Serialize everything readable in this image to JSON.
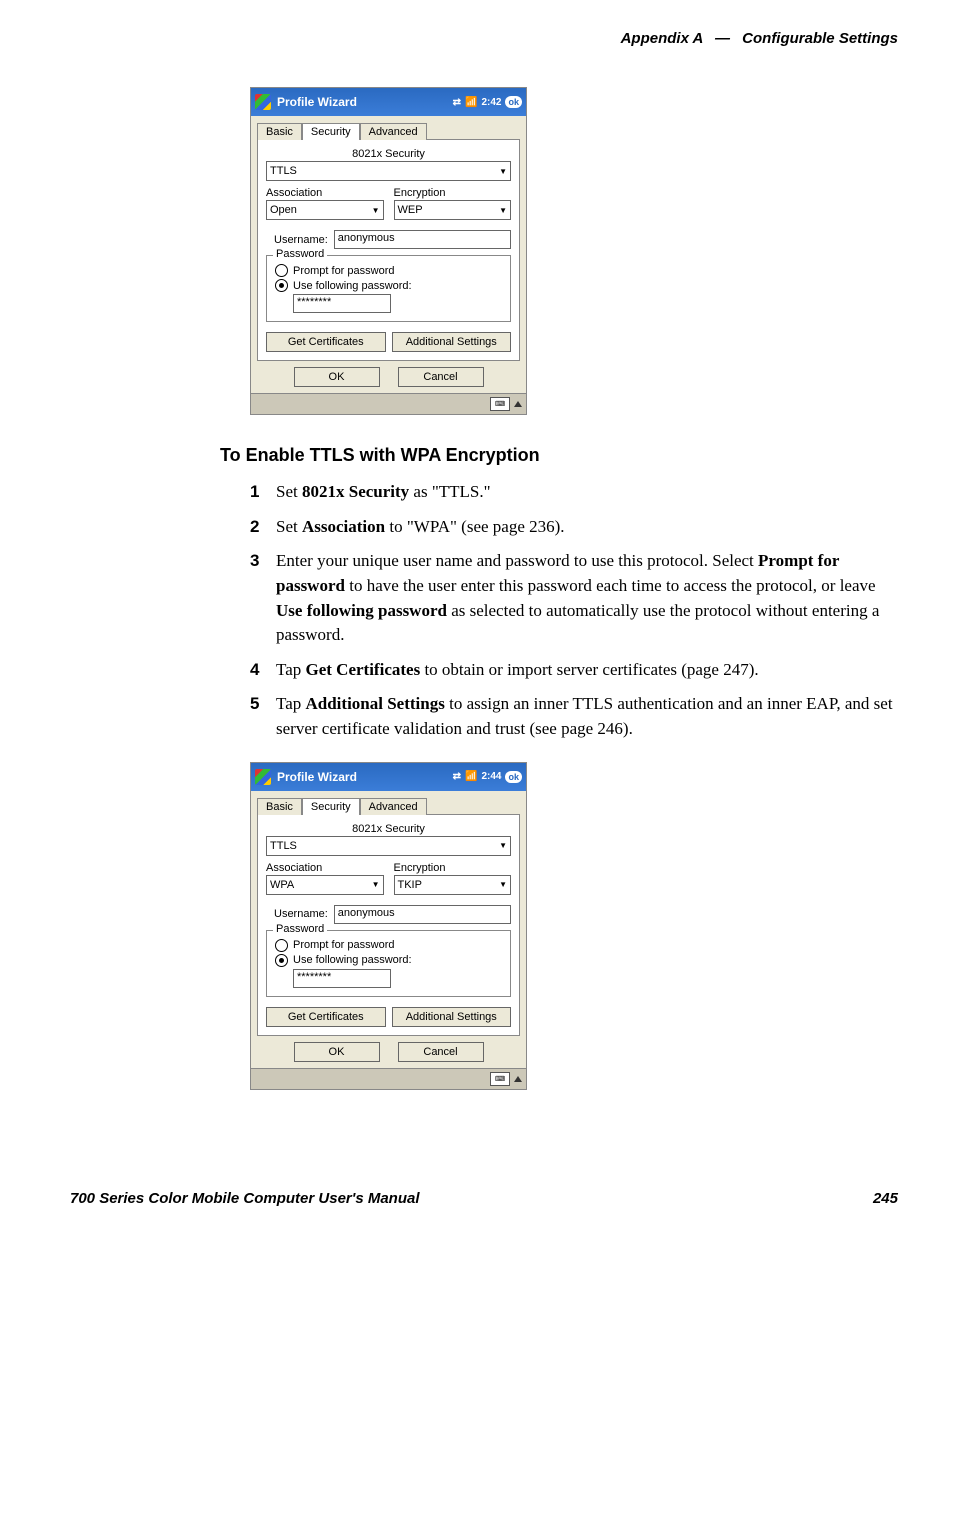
{
  "header": {
    "appendix": "Appendix A",
    "sep": "—",
    "title": "Configurable Settings"
  },
  "footer": {
    "manual": "700 Series Color Mobile Computer User's Manual",
    "page": "245"
  },
  "section_heading": "To Enable TTLS with WPA Encryption",
  "steps": {
    "s1": {
      "num": "1",
      "pre": "Set ",
      "bold": "8021x Security",
      "post": " as \"TTLS.\""
    },
    "s2": {
      "num": "2",
      "pre": "Set ",
      "bold": "Association",
      "post": " to \"WPA\" (see page 236)."
    },
    "s3": {
      "num": "3",
      "p1": "Enter your unique user name and password to use this protocol. Select ",
      "b1": "Prompt for password",
      "p2": " to have the user enter this password each time to access the protocol, or leave ",
      "b2": "Use following password",
      "p3": " as selected to automatically use the protocol without entering a password."
    },
    "s4": {
      "num": "4",
      "pre": "Tap ",
      "bold": "Get Certificates",
      "post": " to obtain or import server certificates (page 247)."
    },
    "s5": {
      "num": "5",
      "pre": "Tap ",
      "bold": "Additional Settings",
      "post": " to assign an inner TTLS authentication and an inner EAP, and set server certificate validation and trust (see page 246)."
    }
  },
  "shot1": {
    "title": "Profile Wizard",
    "time": "2:42",
    "ok": "ok",
    "tabs": {
      "basic": "Basic",
      "security": "Security",
      "advanced": "Advanced"
    },
    "labels": {
      "sec": "8021x Security",
      "assoc": "Association",
      "enc": "Encryption",
      "user": "Username:",
      "pwgroup": "Password",
      "prompt": "Prompt for password",
      "usefollow": "Use following password:"
    },
    "values": {
      "sec": "TTLS",
      "assoc": "Open",
      "enc": "WEP",
      "user": "anonymous",
      "pw": "********"
    },
    "buttons": {
      "getcert": "Get Certificates",
      "addl": "Additional Settings",
      "ok": "OK",
      "cancel": "Cancel"
    }
  },
  "shot2": {
    "title": "Profile Wizard",
    "time": "2:44",
    "ok": "ok",
    "tabs": {
      "basic": "Basic",
      "security": "Security",
      "advanced": "Advanced"
    },
    "labels": {
      "sec": "8021x Security",
      "assoc": "Association",
      "enc": "Encryption",
      "user": "Username:",
      "pwgroup": "Password",
      "prompt": "Prompt for password",
      "usefollow": "Use following password:"
    },
    "values": {
      "sec": "TTLS",
      "assoc": "WPA",
      "enc": "TKIP",
      "user": "anonymous",
      "pw": "********"
    },
    "buttons": {
      "getcert": "Get Certificates",
      "addl": "Additional Settings",
      "ok": "OK",
      "cancel": "Cancel"
    }
  }
}
